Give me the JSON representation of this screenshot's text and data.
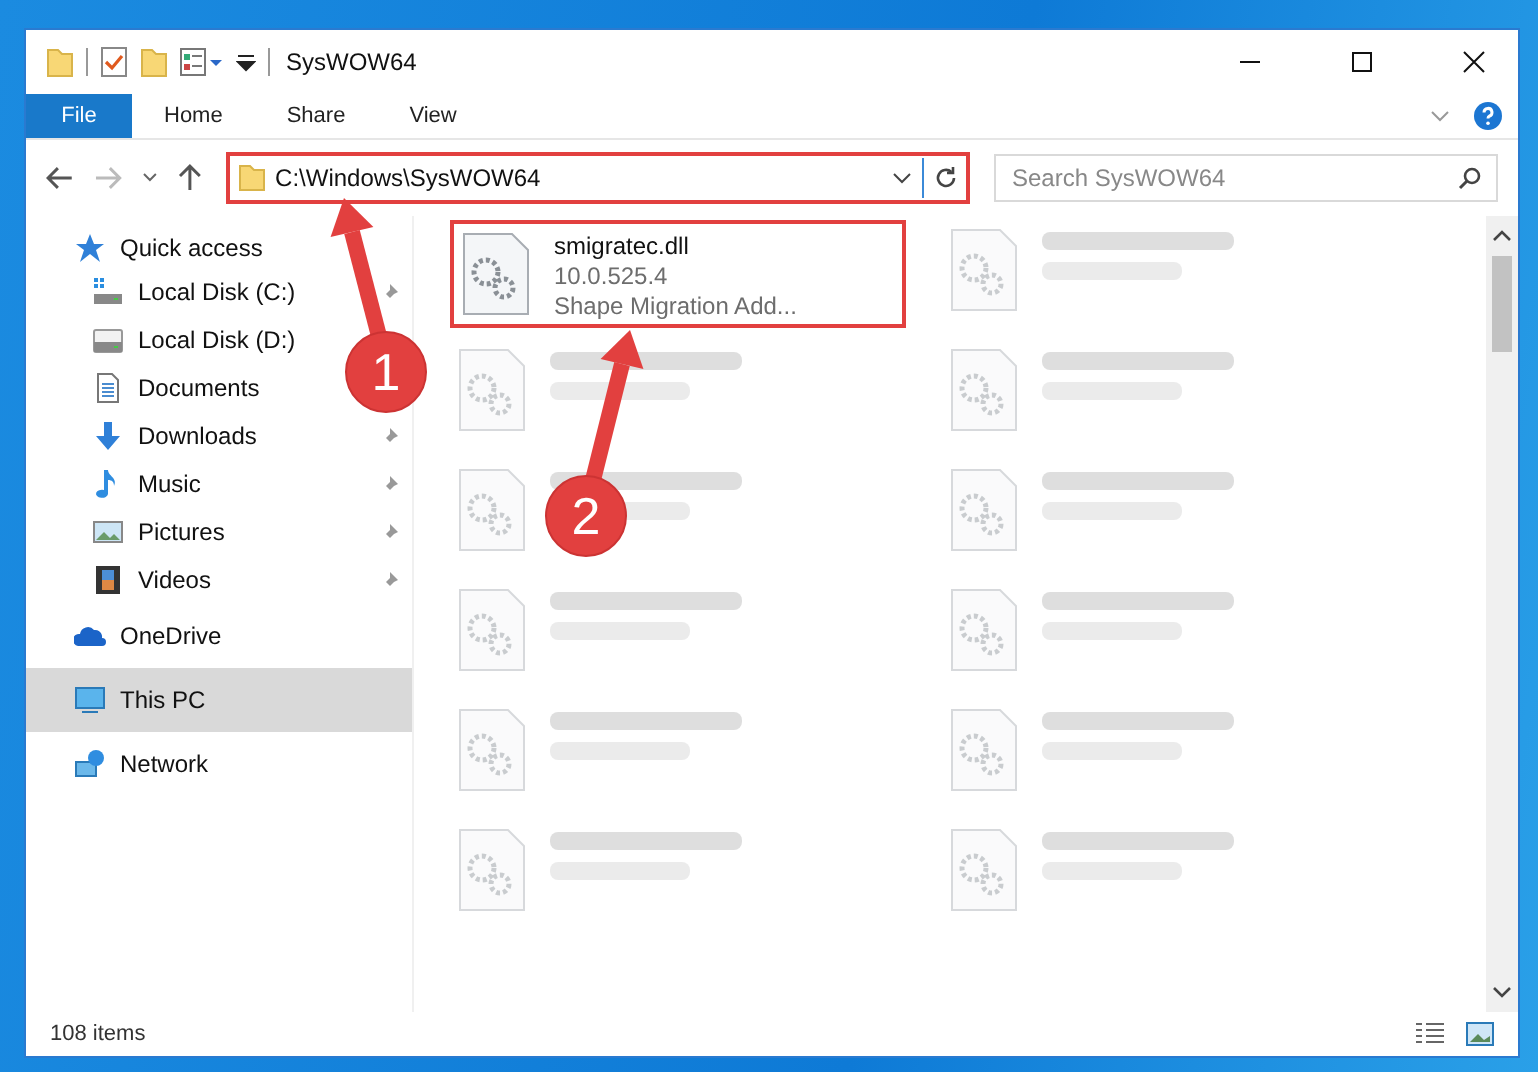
{
  "window": {
    "title": "SysWOW64"
  },
  "ribbon_tabs": [
    {
      "label": "File",
      "selected": true
    },
    {
      "label": "Home",
      "selected": false
    },
    {
      "label": "Share",
      "selected": false
    },
    {
      "label": "View",
      "selected": false
    }
  ],
  "address_bar": {
    "path": "C:\\Windows\\SysWOW64",
    "highlighted": true
  },
  "search": {
    "placeholder": "Search SysWOW64"
  },
  "sidebar": {
    "items": [
      {
        "label": "Quick access",
        "kind": "star",
        "selected": false,
        "children": [
          {
            "label": "Local Disk (C:)",
            "kind": "osdisk",
            "pinned": true,
            "selected": false
          },
          {
            "label": "Local Disk (D:)",
            "kind": "disk",
            "pinned": false,
            "selected": false
          },
          {
            "label": "Documents",
            "kind": "documents",
            "pinned": false,
            "selected": false
          },
          {
            "label": "Downloads",
            "kind": "downloads",
            "pinned": true,
            "selected": false
          },
          {
            "label": "Music",
            "kind": "music",
            "pinned": true,
            "selected": false
          },
          {
            "label": "Pictures",
            "kind": "pictures",
            "pinned": true,
            "selected": false
          },
          {
            "label": "Videos",
            "kind": "videos",
            "pinned": true,
            "selected": false
          }
        ]
      },
      {
        "label": "OneDrive",
        "kind": "cloud",
        "selected": false
      },
      {
        "label": "This PC",
        "kind": "pc",
        "selected": true
      },
      {
        "label": "Network",
        "kind": "network",
        "selected": false
      }
    ]
  },
  "files": [
    {
      "name": "smigratec.dll",
      "lines": [
        "10.0.525.4",
        "Shape Migration Add..."
      ],
      "highlighted": true,
      "blurred": false
    },
    {
      "highlighted": false,
      "blurred": true
    },
    {
      "highlighted": false,
      "blurred": true
    },
    {
      "highlighted": false,
      "blurred": true
    },
    {
      "highlighted": false,
      "blurred": true
    },
    {
      "highlighted": false,
      "blurred": true
    },
    {
      "highlighted": false,
      "blurred": true
    },
    {
      "highlighted": false,
      "blurred": true
    },
    {
      "highlighted": false,
      "blurred": true
    },
    {
      "highlighted": false,
      "blurred": true
    },
    {
      "highlighted": false,
      "blurred": true
    },
    {
      "highlighted": false,
      "blurred": true
    }
  ],
  "status_bar": {
    "count": "108 items"
  },
  "annotations": [
    {
      "number": "1"
    },
    {
      "number": "2"
    }
  ]
}
